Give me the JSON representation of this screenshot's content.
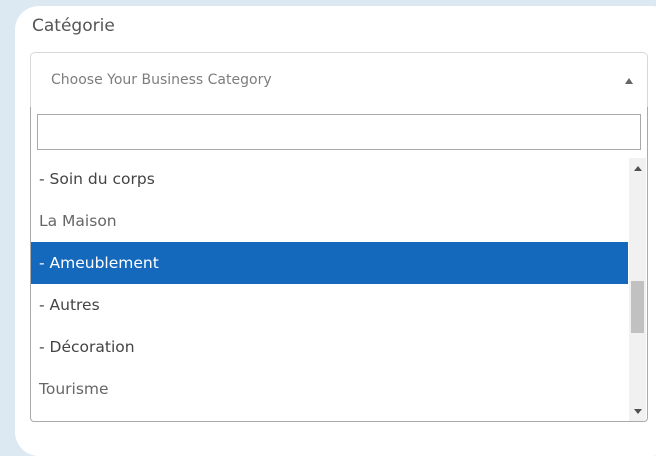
{
  "field": {
    "label": "Catégorie",
    "placeholder": "Choose Your Business Category",
    "arrow_icon": "caret-up-icon"
  },
  "dropdown": {
    "search_value": "",
    "options": [
      {
        "label": "-  Soin du corps",
        "kind": "child",
        "selected": false
      },
      {
        "label": "La Maison",
        "kind": "group",
        "selected": false
      },
      {
        "label": "-  Ameublement",
        "kind": "child",
        "selected": true
      },
      {
        "label": "-  Autres",
        "kind": "child",
        "selected": false
      },
      {
        "label": "-  Décoration",
        "kind": "child",
        "selected": false
      },
      {
        "label": "Tourisme",
        "kind": "group",
        "selected": false
      }
    ],
    "scroll_position_fraction": 0.6
  },
  "colors": {
    "highlight": "#1469bd",
    "background": "#dce9f3",
    "text": "#444444",
    "group_text": "#666666"
  }
}
